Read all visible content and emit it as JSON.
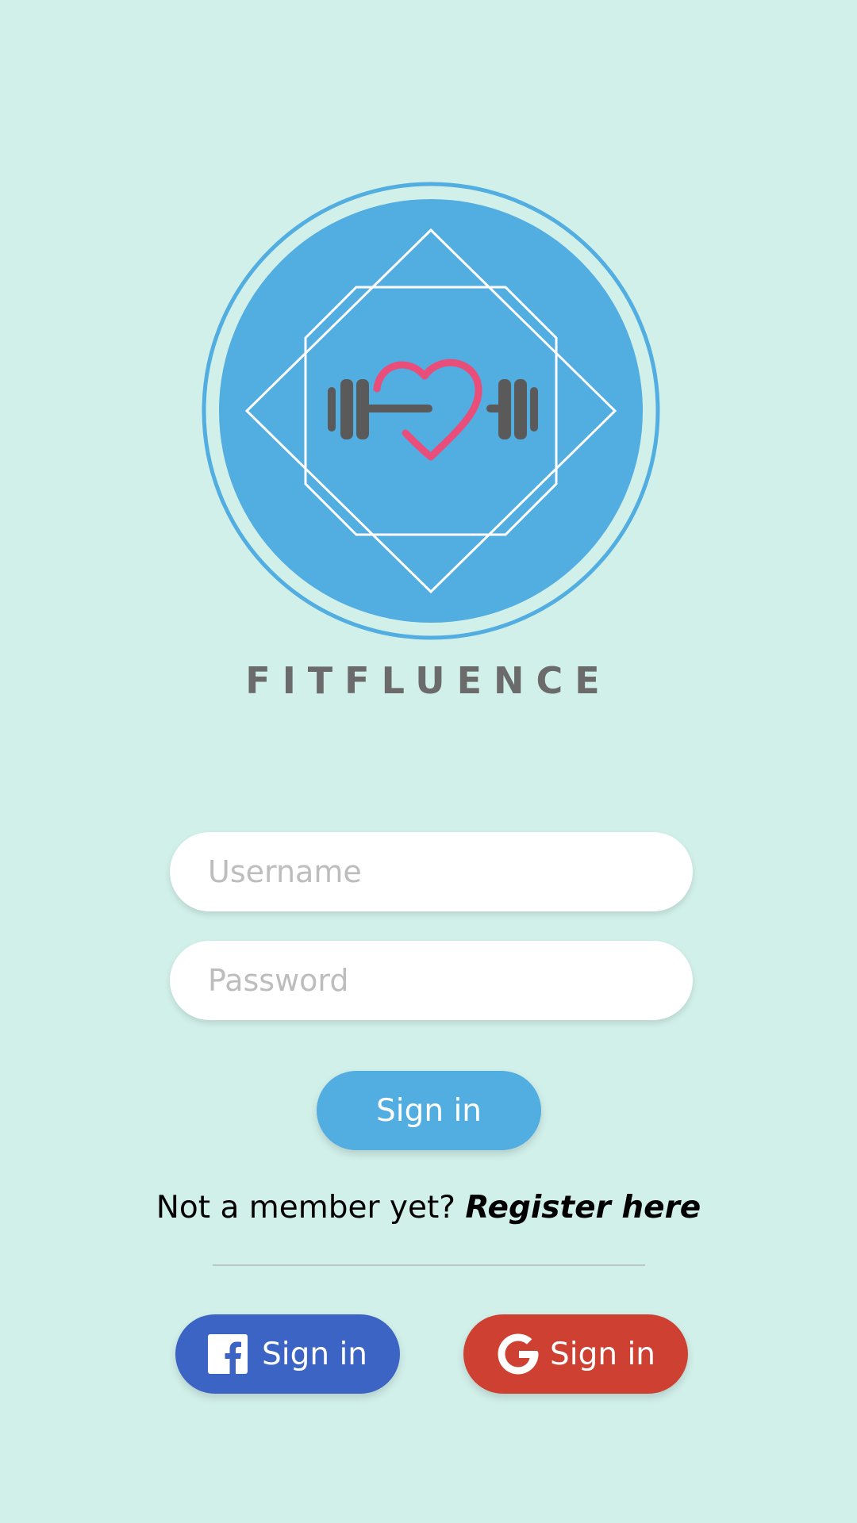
{
  "app": {
    "brand_name": "FITFLUENCE"
  },
  "form": {
    "username_placeholder": "Username",
    "password_placeholder": "Password",
    "signin_label": "Sign in"
  },
  "register": {
    "prompt": "Not a member yet?",
    "link_label": "Register here"
  },
  "social": {
    "facebook_label": "Sign in",
    "google_label": "Sign in"
  },
  "colors": {
    "background": "#d2f0ea",
    "accent": "#52ade1",
    "facebook": "#3b64c4",
    "google": "#ce4132",
    "heart": "#e94e7a"
  },
  "icons": {
    "logo": "dumbbell-heart-logo",
    "facebook": "facebook-icon",
    "google": "google-icon"
  }
}
